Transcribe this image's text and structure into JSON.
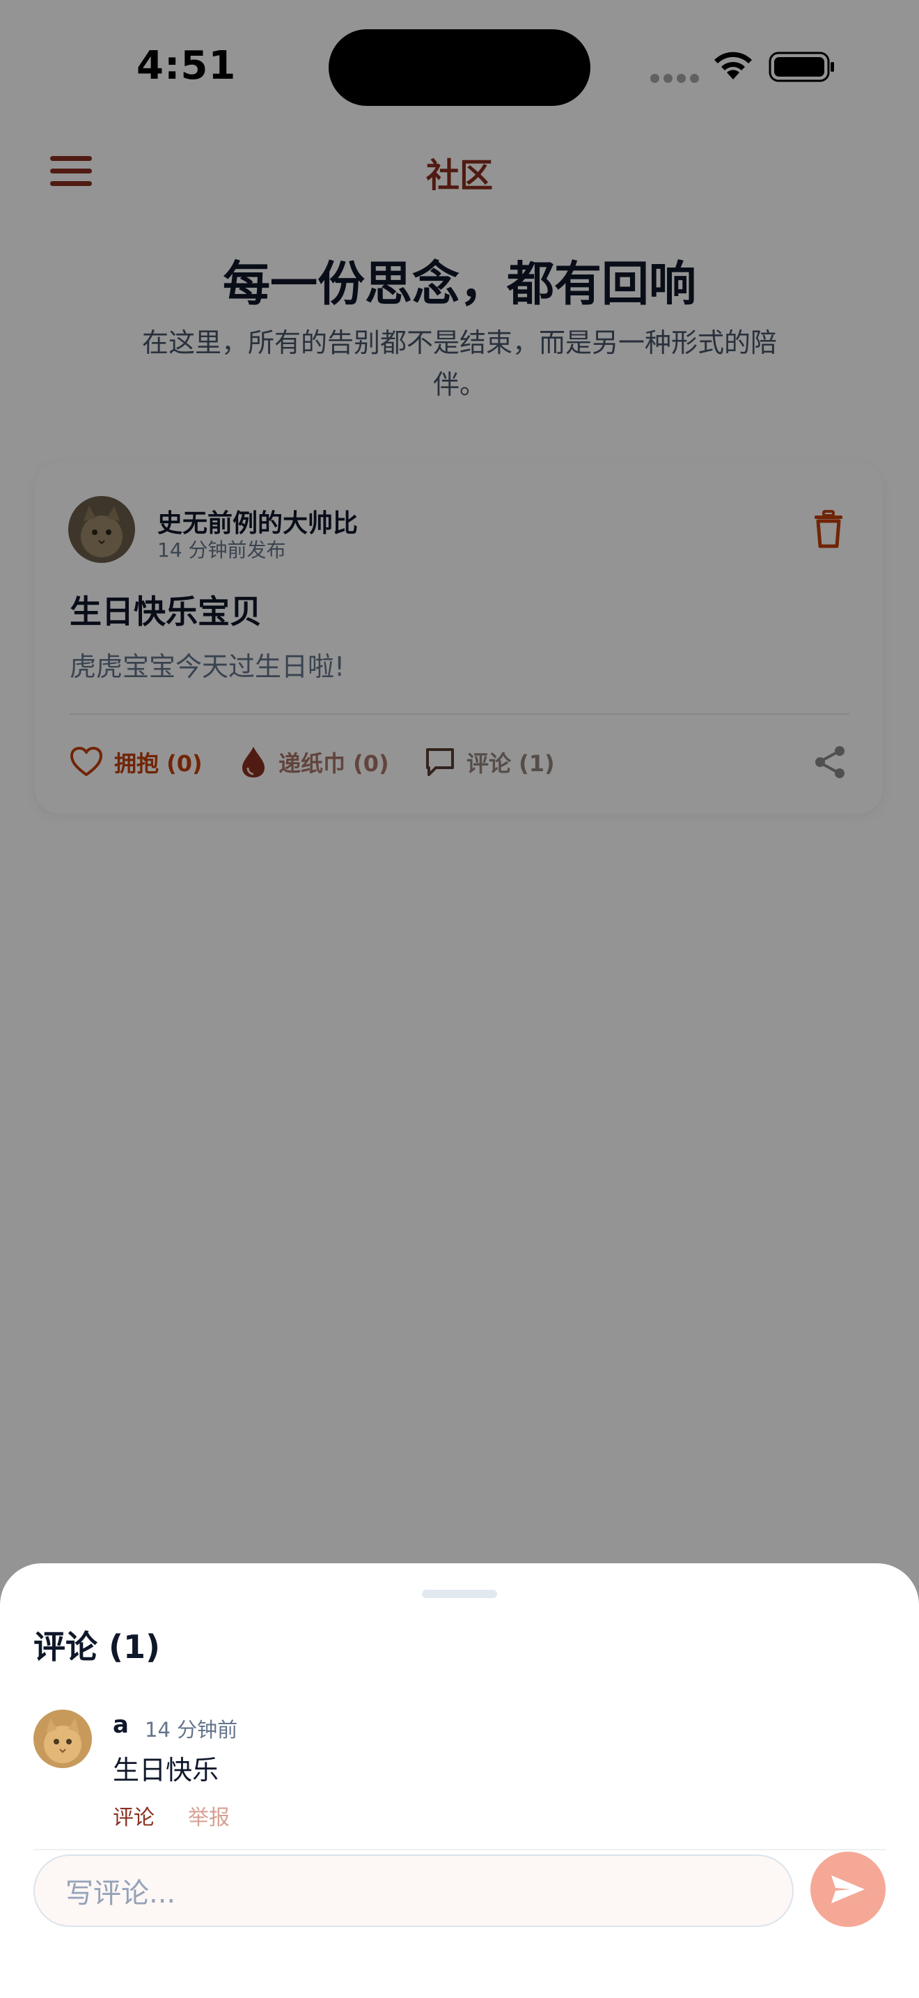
{
  "status_bar": {
    "time": "4:51"
  },
  "header": {
    "title": "社区"
  },
  "hero": {
    "title": "每一份思念，都有回响",
    "subtitle": "在这里，所有的告别都不是结束，而是另一种形式的陪伴。"
  },
  "post": {
    "author": "史无前例的大帅比",
    "time": "14 分钟前发布",
    "title": "生日快乐宝贝",
    "body": "虎虎宝宝今天过生日啦!",
    "actions": {
      "hug": "拥抱 (0)",
      "tissue": "递纸巾 (0)",
      "comment": "评论 (1)"
    }
  },
  "comments_sheet": {
    "title": "评论 (1)",
    "comments": [
      {
        "author": "a",
        "time": "14 分钟前",
        "text": "生日快乐",
        "reply_label": "评论",
        "report_label": "举报"
      }
    ],
    "input_placeholder": "写评论..."
  },
  "colors": {
    "brand": "#8a3020",
    "accent": "#c2410c",
    "send_button": "#f5a896",
    "overlay": "rgba(0,0,0,0.42)"
  },
  "icons": {
    "menu": "hamburger-menu-icon",
    "delete": "trash-icon",
    "hug": "heart-icon",
    "tissue": "drop-icon",
    "comment": "speech-bubble-icon",
    "share": "share-icon",
    "send": "paper-plane-icon"
  }
}
